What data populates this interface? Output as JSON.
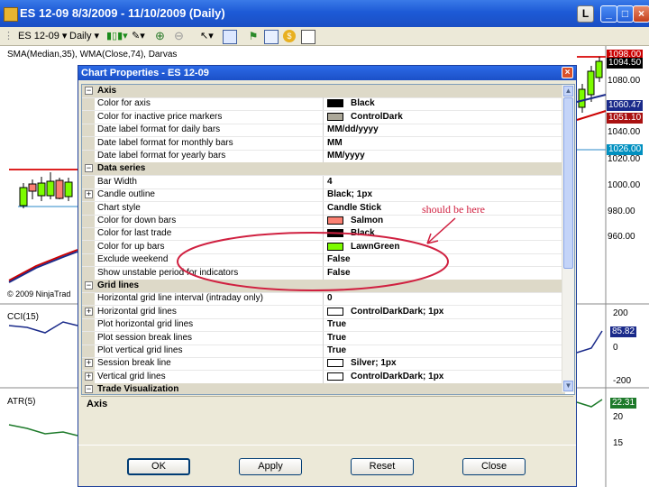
{
  "window": {
    "title": "ES 12-09  8/3/2009 - 11/10/2009 (Daily)",
    "l_button": "L",
    "min_glyph": "_",
    "max_glyph": "□",
    "close_glyph": "×"
  },
  "toolbar": {
    "instrument": "ES 12-09 ▾",
    "interval": "Daily ▾",
    "bar_type_glyph": "▮▯▮▾",
    "draw_glyph": "✎▾",
    "zoom_in_glyph": "⊕",
    "zoom_out_glyph": "⊖",
    "cursor_glyph": "↖▾"
  },
  "chart": {
    "indicator_label": "SMA(Median,35), WMA(Close,74), Darvas",
    "copyright": "© 2009 NinjaTrad",
    "cci_label": "CCI(15)",
    "atr_label": "ATR(5)",
    "price_labels": [
      "1080.00",
      "1040.00",
      "1020.00",
      "1000.00",
      "980.00",
      "960.00"
    ],
    "price_boxes": [
      {
        "text": "1098.00",
        "color": "#cc0000"
      },
      {
        "text": "1094.50",
        "color": "#000000"
      },
      {
        "text": "1060.47",
        "color": "#1a2a8a"
      },
      {
        "text": "1051.10",
        "color": "#aa1111"
      },
      {
        "text": "1026.00",
        "color": "#0090c0"
      }
    ],
    "cci_labels": [
      "200",
      "0",
      "-200"
    ],
    "cci_value": "85.82",
    "atr_labels": [
      "20",
      "15"
    ],
    "atr_value": "22.31",
    "colors": {
      "cci_box": "#1a2a8a",
      "atr_box": "#1d7a2a"
    }
  },
  "dialog": {
    "title": "Chart Properties - ES 12-09",
    "close_glyph": "×",
    "categories": [
      {
        "name": "Axis",
        "rows": [
          {
            "name": "Color for axis",
            "value": "Black",
            "swatch": "#000000"
          },
          {
            "name": "Color for inactive price markers",
            "value": "ControlDark",
            "swatch": "#aca899"
          },
          {
            "name": "Date label format for daily bars",
            "value": "MM/dd/yyyy"
          },
          {
            "name": "Date label format for monthly bars",
            "value": "MM"
          },
          {
            "name": "Date label format for yearly bars",
            "value": "MM/yyyy"
          }
        ]
      },
      {
        "name": "Data series",
        "rows": [
          {
            "name": "Bar Width",
            "value": "4"
          },
          {
            "name": "Candle outline",
            "value": "Black; 1px",
            "expand": true
          },
          {
            "name": "Chart style",
            "value": "Candle Stick"
          },
          {
            "name": "Color for down bars",
            "value": "Salmon",
            "swatch": "#fa8072"
          },
          {
            "name": "Color for last trade",
            "value": "Black",
            "swatch": "#000000"
          },
          {
            "name": "Color for up bars",
            "value": "LawnGreen",
            "swatch": "#7cfc00"
          },
          {
            "name": "Exclude weekend",
            "value": "False"
          },
          {
            "name": "Show unstable period for indicators",
            "value": "False"
          }
        ]
      },
      {
        "name": "Grid lines",
        "rows": [
          {
            "name": "Horizontal grid line interval (intraday only)",
            "value": "0"
          },
          {
            "name": "Horizontal grid lines",
            "value": "ControlDarkDark; 1px",
            "expand": true,
            "swatch": "#ffffff"
          },
          {
            "name": "Plot horizontal grid lines",
            "value": "True"
          },
          {
            "name": "Plot session break lines",
            "value": "True"
          },
          {
            "name": "Plot vertical grid lines",
            "value": "True"
          },
          {
            "name": "Session break line",
            "value": "Silver; 1px",
            "expand": true,
            "swatch": "#ffffff"
          },
          {
            "name": "Vertical grid lines",
            "value": "ControlDarkDark; 1px",
            "expand": true,
            "swatch": "#ffffff"
          }
        ]
      },
      {
        "name": "Trade Visualization",
        "rows": []
      }
    ],
    "description_title": "Axis",
    "buttons": {
      "ok": "OK",
      "apply": "Apply",
      "reset": "Reset",
      "close": "Close"
    },
    "scroll_up_glyph": "▲",
    "scroll_down_glyph": "▼"
  },
  "annotation": {
    "text": "should be here",
    "color": "#d02040"
  }
}
